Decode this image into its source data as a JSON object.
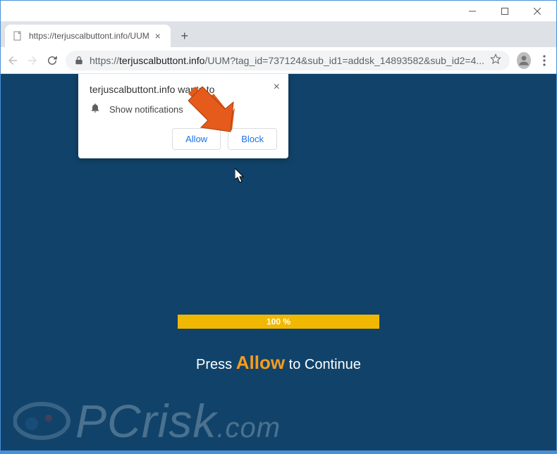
{
  "window": {
    "minimize": "–",
    "maximize": "□",
    "close": "×"
  },
  "tab": {
    "title": "https://terjuscalbuttont.info/UUM",
    "close": "×"
  },
  "newtab": "+",
  "url": {
    "scheme": "https://",
    "domain": "terjuscalbuttont.info",
    "path": "/UUM?tag_id=737124&sub_id1=addsk_14893582&sub_id2=4..."
  },
  "notification": {
    "title": "terjuscalbuttont.info wants to",
    "text": "Show notifications",
    "allow": "Allow",
    "block": "Block",
    "close": "×"
  },
  "progress": {
    "label": "100 %"
  },
  "message": {
    "pre": "Press ",
    "allow": "Allow",
    "post": " to Continue"
  },
  "watermark": {
    "text_p": "P",
    "text_c": "C",
    "text_risk": "risk",
    "text_dotcom": ".com"
  }
}
